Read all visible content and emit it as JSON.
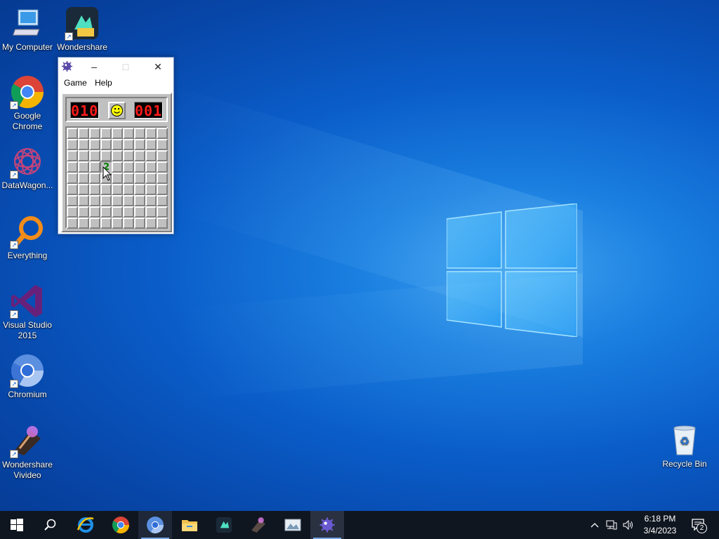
{
  "desktop": {
    "icons": [
      {
        "label": "My Computer"
      },
      {
        "label": "Wondershare Filmora"
      },
      {
        "label": "Google Chrome"
      },
      {
        "label": "DataWagon..."
      },
      {
        "label": "Everything"
      },
      {
        "label": "Visual Studio 2015"
      },
      {
        "label": "Chromium"
      },
      {
        "label": "Wondershare Vivideo"
      },
      {
        "label": "Recycle Bin"
      }
    ]
  },
  "minesweeper": {
    "title": "",
    "menu": [
      "Game",
      "Help"
    ],
    "mine_counter": "010",
    "timer": "001",
    "face": "smiley",
    "grid": {
      "rows": 9,
      "cols": 9,
      "revealed": [
        {
          "row": 3,
          "col": 3,
          "value": "2"
        }
      ]
    }
  },
  "taskbar": {
    "apps": [
      "start-icon",
      "search-icon",
      "internet-explorer-icon",
      "chrome-icon",
      "chromium-icon",
      "file-explorer-icon",
      "filmora-icon",
      "vivideo-icon",
      "image-viewer-icon",
      "minesweeper-icon"
    ],
    "active": "minesweeper-icon",
    "clock": {
      "time": "6:18 PM",
      "date": "3/4/2023"
    },
    "notifications": "2"
  },
  "colors": {
    "taskbar": "#101620",
    "accent": "#76a6e8",
    "lcd_text": "#ff1a1a",
    "number_2": "#008000"
  }
}
